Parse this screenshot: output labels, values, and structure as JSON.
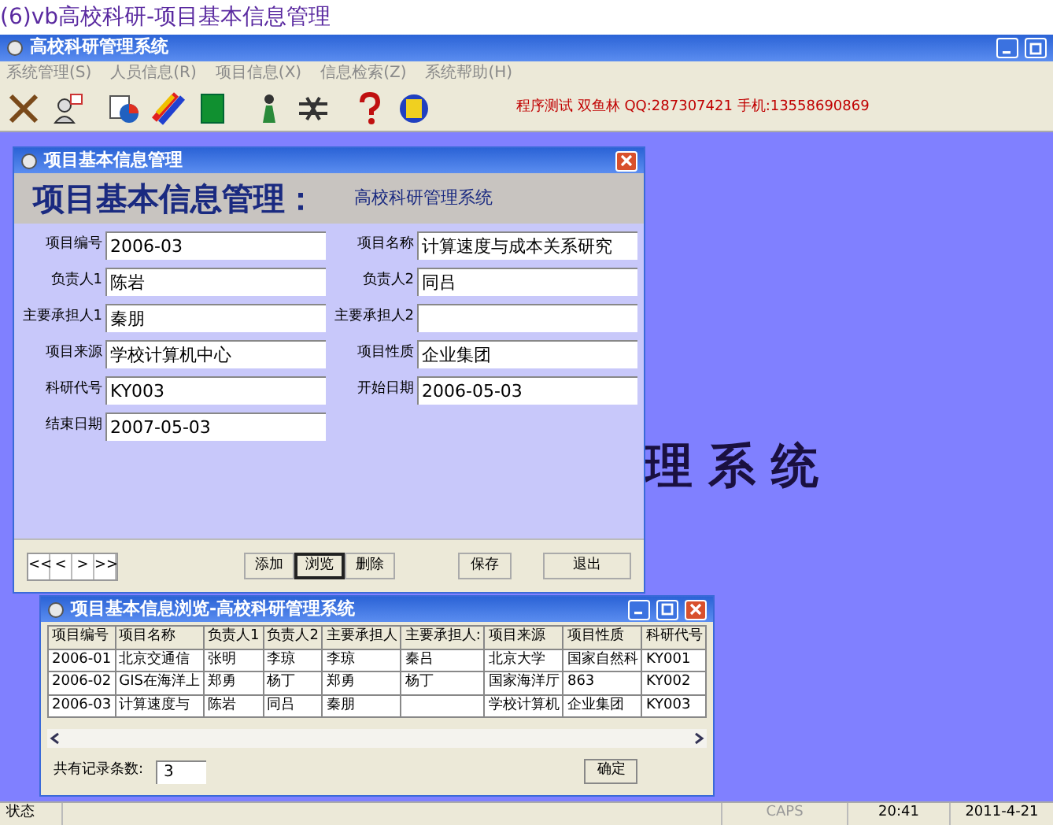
{
  "caption": "(6)vb高校科研-项目基本信息管理",
  "window": {
    "title": "高校科研管理系统"
  },
  "menu": [
    {
      "label": "系统管理(S)"
    },
    {
      "label": "人员信息(R)"
    },
    {
      "label": "项目信息(X)"
    },
    {
      "label": "信息检索(Z)"
    },
    {
      "label": "系统帮助(H)"
    }
  ],
  "toolbar": {
    "info": "程序测试 双鱼林 QQ:287307421 手机:13558690869"
  },
  "desktop_banner": "理系统",
  "edit_dialog": {
    "title": "项目基本信息管理",
    "heading": "项目基本信息管理：",
    "subheading": "高校科研管理系统",
    "fields": [
      {
        "label": "项目编号",
        "value": "2006-03"
      },
      {
        "label": "项目名称",
        "value": "计算速度与成本关系研究"
      },
      {
        "label": "负责人1",
        "value": "陈岩"
      },
      {
        "label": "负责人2",
        "value": "同吕"
      },
      {
        "label": "主要承担人1",
        "value": "秦朋"
      },
      {
        "label": "主要承担人2"
      },
      {
        "label": "项目来源",
        "value": "学校计算机中心"
      },
      {
        "label": "项目性质",
        "value": "企业集团"
      },
      {
        "label": "科研代号",
        "value": "KY003"
      },
      {
        "label": "开始日期",
        "value": "2006-05-03"
      },
      {
        "label": "结束日期",
        "value": "2007-05-03"
      }
    ],
    "nav_buttons": [
      "<<",
      "<",
      ">",
      ">>"
    ],
    "buttons": [
      {
        "label": "添加",
        "selected": false
      },
      {
        "label": "浏览",
        "selected": true
      },
      {
        "label": "删除",
        "selected": false
      }
    ],
    "save": "保存",
    "exit": "退出"
  },
  "browse_dialog": {
    "title": "项目基本信息浏览-高校科研管理系统",
    "table": {
      "columns": [
        "项目编号",
        "项目名称",
        "负责人1",
        "负责人2",
        "主要承担人",
        "主要承担人:",
        "项目来源",
        "项目性质",
        "科研代号"
      ],
      "rows": [
        [
          "2006-01",
          "北京交通信",
          "张明",
          "李琼",
          "李琼",
          "秦吕",
          "北京大学",
          "国家自然科",
          "KY001"
        ],
        [
          "2006-02",
          "GIS在海洋上",
          "郑勇",
          "杨丁",
          "郑勇",
          "杨丁",
          "国家海洋厅",
          "863",
          "KY002"
        ],
        [
          "2006-03",
          "计算速度与",
          "陈岩",
          "同吕",
          "秦朋",
          null,
          "学校计算机",
          "企业集团",
          "KY003"
        ]
      ]
    },
    "count_label": "共有记录条数:",
    "count": "3",
    "ok": "确定"
  },
  "status_bar": {
    "status": "状态",
    "caps": "CAPS",
    "time": "20:41",
    "date": "2011-4-21"
  }
}
